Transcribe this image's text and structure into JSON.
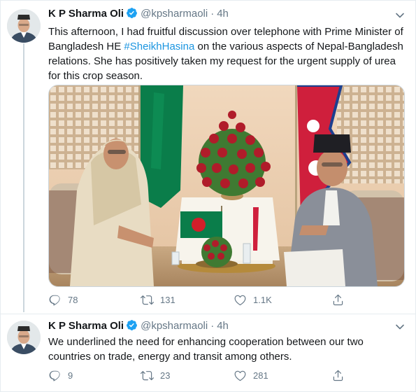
{
  "tweets": [
    {
      "author_name": "K P Sharma Oli",
      "handle": "@kpsharmaoli",
      "separator": "·",
      "time": "4h",
      "text_before": "This afternoon, I had fruitful discussion over telephone with Prime Minister of Bangladesh HE ",
      "hashtag": "#SheikhHasina",
      "text_after": " on the various aspects of Nepal-Bangladesh relations. She has positively taken my request for the urgent supply of urea  for this crop season.",
      "replies": "78",
      "retweets": "131",
      "likes": "1.1K"
    },
    {
      "author_name": "K P Sharma Oli",
      "handle": "@kpsharmaoli",
      "separator": "·",
      "time": "4h",
      "text": "We underlined the need for enhancing cooperation between our two countries on trade, energy and transit among others.",
      "replies": "9",
      "retweets": "23",
      "likes": "281"
    }
  ],
  "icons": {
    "verified": "verified-badge-icon",
    "caret": "chevron-down-icon",
    "reply": "reply-icon",
    "retweet": "retweet-icon",
    "like": "heart-icon",
    "share": "share-icon"
  },
  "colors": {
    "link": "#1b95e0",
    "verified": "#1da1f2",
    "muted": "#657786",
    "border": "#e6ecf0"
  }
}
